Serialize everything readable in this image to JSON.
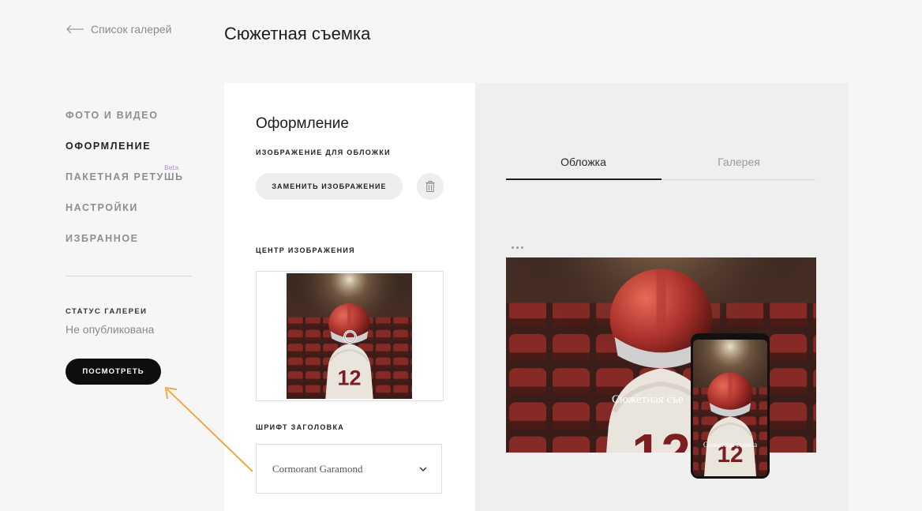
{
  "back_link": {
    "label": "Список галерей"
  },
  "page_title": "Сюжетная съемка",
  "nav": {
    "items": [
      {
        "label": "ФОТО И ВИДЕО",
        "active": false
      },
      {
        "label": "ОФОРМЛЕНИЕ",
        "active": true
      },
      {
        "label": "ПАКЕТНАЯ РЕТУШЬ",
        "active": false,
        "badge": "Beta"
      },
      {
        "label": "НАСТРОЙКИ",
        "active": false
      },
      {
        "label": "ИЗБРАННОЕ",
        "active": false
      }
    ]
  },
  "gallery_status": {
    "label": "СТАТУС ГАЛЕРЕИ",
    "value": "Не опубликована"
  },
  "view_button": {
    "label": "ПОСМОТРЕТЬ"
  },
  "design": {
    "title": "Оформление",
    "cover_label": "ИЗОБРАЖЕНИЕ ДЛЯ ОБЛОЖКИ",
    "replace_button": "ЗАМЕНИТЬ ИЗОБРАЖЕНИЕ",
    "focus_label": "ЦЕНТР ИЗОБРАЖЕНИЯ",
    "font_label": "ШРИФТ ЗАГОЛОВКА",
    "font_value": "Cormorant Garamond"
  },
  "preview": {
    "tabs": [
      {
        "label": "Обложка",
        "active": true
      },
      {
        "label": "Галерея",
        "active": false
      }
    ],
    "desktop_title": "Сюжетная съе",
    "mobile_title": "Сюжетная съемка"
  },
  "icons": {
    "back": "arrow-left-icon",
    "trash": "trash-icon",
    "chevron": "chevron-down-icon",
    "more": "more-dots-icon"
  },
  "colors": {
    "accent_beta": "#c48ad6",
    "annotation_arrow": "#f0a84a",
    "primary_button": "#0e0e0e"
  }
}
